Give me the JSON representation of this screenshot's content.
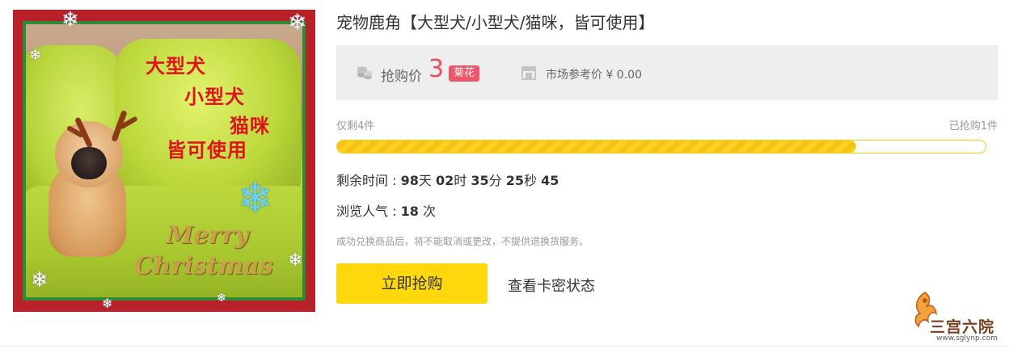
{
  "product": {
    "title": "宠物鹿角【大型犬/小型犬/猫咪，皆可使用】",
    "image": {
      "overlay_text": [
        "大型犬",
        "小型犬",
        "猫咪",
        "皆可使用"
      ],
      "xmas_text": [
        "Merry",
        "Christmas"
      ]
    }
  },
  "price": {
    "label": "抢购价",
    "value": "3",
    "currency": "菊花",
    "market_label": "市场参考价 ¥ 0.00",
    "coin_icon": "coins-icon",
    "market_icon": "storefront-icon"
  },
  "stock": {
    "remaining": "仅剩4件",
    "sold": "已抢购1件",
    "progress_fraction": 0.8
  },
  "timer": {
    "label": "剩余时间 : ",
    "days": "98",
    "days_unit": "天",
    "hours": "02",
    "hours_unit": "时",
    "minutes": "35",
    "minutes_unit": "分",
    "seconds": "25",
    "seconds_unit": "秒",
    "tenths": "45"
  },
  "views": {
    "label": "浏览人气 : ",
    "count": "18",
    "unit": "次"
  },
  "notice": "成功兑换商品后，将不能取消或更改，不提供退换货服务。",
  "actions": {
    "buy_label": "立即抢购",
    "status_label": "查看卡密状态"
  },
  "watermark": {
    "text": "三宫六院",
    "url": "www.sglynp.com"
  },
  "colors": {
    "price_accent": "#ef4b5d",
    "button_yellow": "#fcd80c",
    "progress_yellow": "#fdd124",
    "image_border_red": "#b8202a",
    "image_border_green": "#2f8a34",
    "overlay_red": "#e0121b"
  }
}
